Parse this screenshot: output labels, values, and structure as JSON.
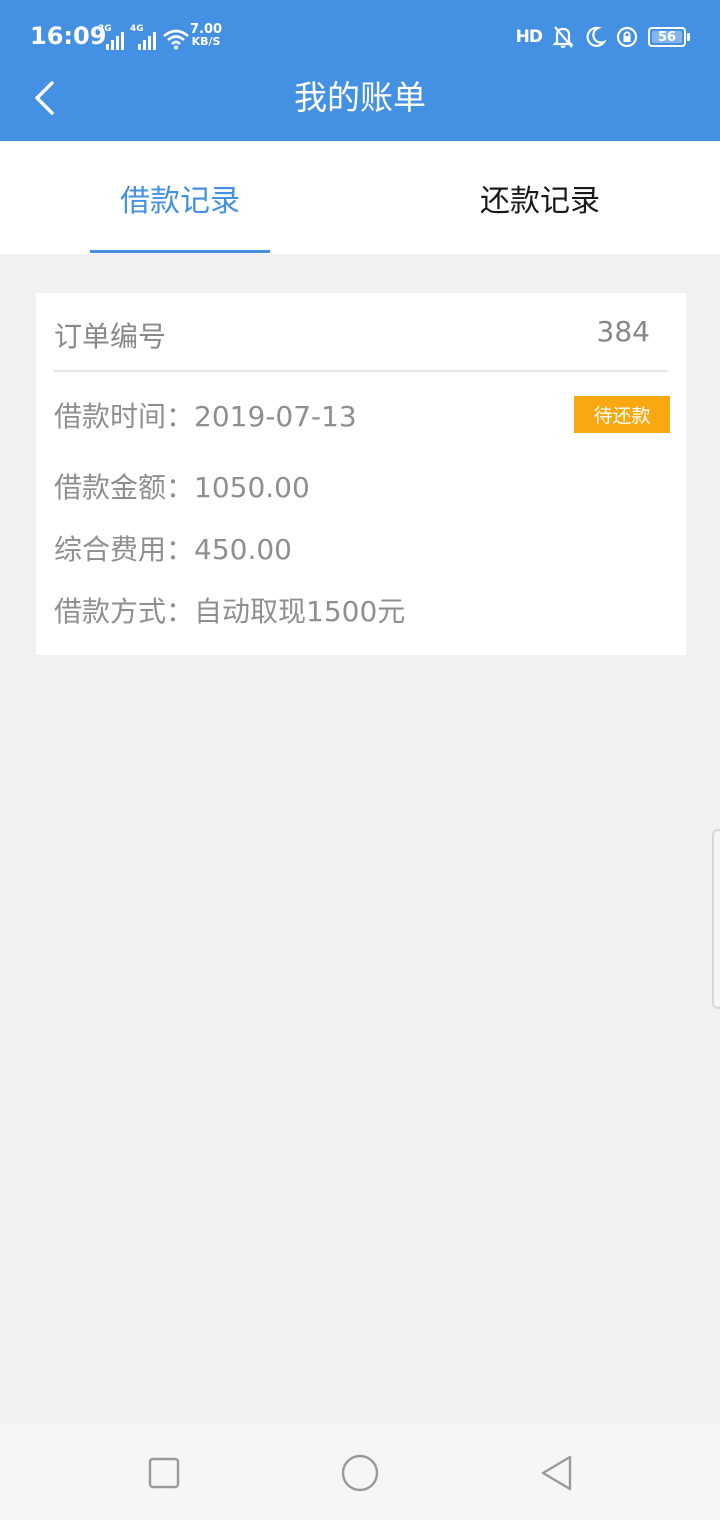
{
  "status_bar": {
    "time": "16:09",
    "signal1_label": "3G",
    "signal2_label": "4G",
    "speed_value": "7.00",
    "speed_unit": "KB/S",
    "hd_label": "HD",
    "battery": "56"
  },
  "header": {
    "title": "我的账单",
    "background": "#4491e4"
  },
  "tabs": [
    {
      "label": "借款记录",
      "active": true
    },
    {
      "label": "还款记录",
      "active": false
    }
  ],
  "record": {
    "order_label": "订单编号",
    "order_number": "384",
    "status_badge": "待还款",
    "borrow_time_label": "借款时间：",
    "borrow_time": "2019-07-13",
    "amount_label": "借款金额：",
    "amount": "1050.00",
    "fee_label": "综合费用：",
    "fee": "450.00",
    "method_label": "借款方式：",
    "method": "自动取现1500元"
  },
  "colors": {
    "accent": "#4491e4",
    "badge": "#f9a811",
    "text_gray": "#8f8f8f"
  },
  "icons": {
    "back": "chevron-left-icon",
    "nav_recent": "square-icon",
    "nav_home": "circle-icon",
    "nav_back": "triangle-back-icon"
  }
}
